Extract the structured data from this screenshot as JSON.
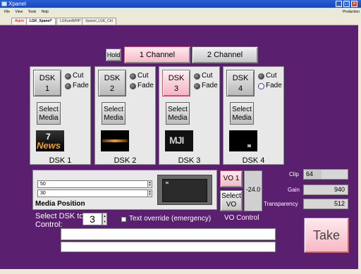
{
  "window": {
    "title": "Xpanel"
  },
  "menu": {
    "file": "File",
    "view": "View",
    "tools": "Tools",
    "help": "Help",
    "right_label": "Production"
  },
  "tabs": [
    {
      "prefix": "Alarm",
      "label": ""
    },
    {
      "prefix": "",
      "label": "LGK_Xpanel*"
    },
    {
      "prefix": "",
      "label": "LGKandMHP"
    },
    {
      "prefix": "",
      "label": "Xpanel_LGK_Ctrl"
    }
  ],
  "header": {
    "hold": "Hold",
    "channel1": "1 Channel",
    "channel2": "2 Channel"
  },
  "dsk_panels": [
    {
      "button_line1": "DSK",
      "button_line2": "1",
      "cut": "Cut",
      "fade": "Fade",
      "select_line1": "Select",
      "select_line2": "Media",
      "thumb_text": "News",
      "label": "DSK 1"
    },
    {
      "button_line1": "DSK",
      "button_line2": "2",
      "cut": "Cut",
      "fade": "Fade",
      "select_line1": "Select",
      "select_line2": "Media",
      "thumb_text": "",
      "label": "DSK 2"
    },
    {
      "button_line1": "DSK",
      "button_line2": "3",
      "cut": "Cut",
      "fade": "Fade",
      "select_line1": "Select",
      "select_line2": "Media",
      "thumb_text": "MJI",
      "label": "DSK 3"
    },
    {
      "button_line1": "DSK",
      "button_line2": "4",
      "cut": "Cut",
      "fade": "Fade",
      "select_line1": "Select",
      "select_line2": "Media",
      "thumb_text": "",
      "label": "DSK 4"
    }
  ],
  "media_position": {
    "label": "Media Position",
    "value1": "50",
    "value2": "30"
  },
  "vo": {
    "vo1": "VO 1",
    "select_line1": "Select",
    "select_line2": "VO",
    "level": "-24.0",
    "label": "VO Control"
  },
  "controls": {
    "clip_label": "Clip",
    "clip_value": "64",
    "gain_label": "Gain",
    "gain_value": "940",
    "transparency_label": "Transparency",
    "transparency_value": "512"
  },
  "select_dsk": {
    "label_line1": "Select DSK to",
    "label_line2": "Control:",
    "value": "3"
  },
  "text_override": {
    "label": "Text override (emergency)"
  },
  "take": {
    "label": "Take"
  },
  "colors": {
    "background": "#5a1f6e",
    "accent_pink": "#f6b8c4"
  }
}
